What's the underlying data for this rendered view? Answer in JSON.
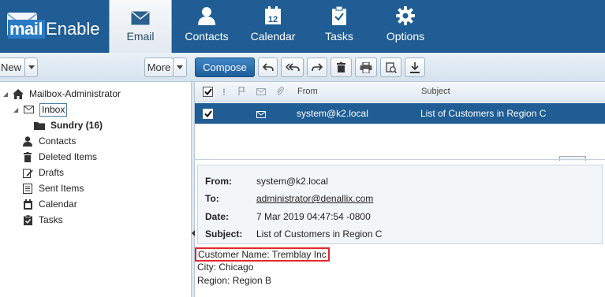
{
  "brand": {
    "mail": "mail",
    "enable": "Enable"
  },
  "nav": [
    {
      "label": "Email",
      "icon": "email-icon",
      "active": true
    },
    {
      "label": "Contacts",
      "icon": "contacts-icon",
      "active": false
    },
    {
      "label": "Calendar",
      "icon": "calendar-icon",
      "active": false,
      "icon_text": "12"
    },
    {
      "label": "Tasks",
      "icon": "tasks-icon",
      "active": false
    },
    {
      "label": "Options",
      "icon": "options-gear-icon",
      "active": false
    }
  ],
  "toolbar": {
    "new_label": "New",
    "more_label": "More",
    "compose_label": "Compose",
    "icons": [
      "reply-icon",
      "reply-all-icon",
      "forward-icon",
      "delete-icon",
      "print-icon",
      "move-icon",
      "download-icon"
    ]
  },
  "tree": {
    "root": "Mailbox-Administrator",
    "inbox": "Inbox",
    "sundry": "Sundry (16)",
    "items": [
      "Contacts",
      "Deleted Items",
      "Drafts",
      "Sent Items",
      "Calendar",
      "Tasks"
    ]
  },
  "list": {
    "col_from": "From",
    "col_subject": "Subject",
    "rows": [
      {
        "from": "system@k2.local",
        "subject": "List of Customers in Region C",
        "selected": true,
        "checked": true
      }
    ]
  },
  "preview": {
    "from_label": "From:",
    "from_value": "system@k2.local",
    "to_label": "To:",
    "to_value": "administrator@denallix.com",
    "date_label": "Date:",
    "date_value": "7 Mar 2019 04:47:54 -0800",
    "subject_label": "Subject:",
    "subject_value": "List of Customers in Region C",
    "body": [
      "Customer Name: Tremblay Inc",
      "City: Chicago",
      "Region: Region B"
    ]
  },
  "colors": {
    "nav_bg": "#1f5d94",
    "highlight_border": "#e0282d",
    "selected_row": "#1f5d94"
  }
}
